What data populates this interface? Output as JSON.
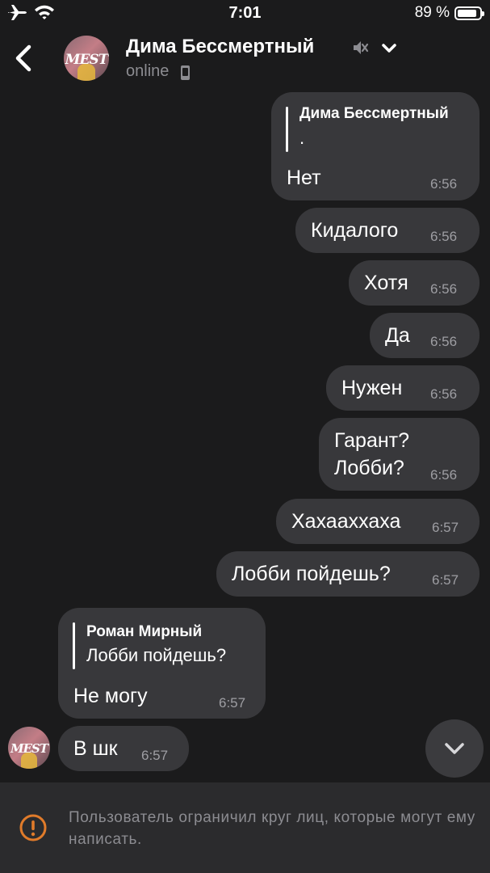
{
  "status_bar": {
    "time": "7:01",
    "battery_percent": "89 %",
    "battery_level": 0.89,
    "airplane_icon": "airplane-icon",
    "wifi_icon": "wifi-icon"
  },
  "header": {
    "back_icon": "chevron-left-icon",
    "avatar_text": "MEST",
    "contact_name": "Дима Бессмертный",
    "muted_icon": "speaker-muted-icon",
    "expand_icon": "chevron-down-icon",
    "status": "online"
  },
  "messages": [
    {
      "direction": "outgoing",
      "reply_author": "Дима Бессмертный",
      "reply_text": ".",
      "text": "Нет",
      "time": "6:56"
    },
    {
      "direction": "outgoing",
      "text": "Кидалого",
      "time": "6:56"
    },
    {
      "direction": "outgoing",
      "text": "Хотя",
      "time": "6:56"
    },
    {
      "direction": "outgoing",
      "text": "Да",
      "time": "6:56"
    },
    {
      "direction": "outgoing",
      "text": "Нужен",
      "time": "6:56"
    },
    {
      "direction": "outgoing",
      "text_line1": "Гарант?",
      "text_line2": "Лобби?",
      "time": "6:56"
    },
    {
      "direction": "outgoing",
      "text": "Хахааххаха",
      "time": "6:57"
    },
    {
      "direction": "outgoing",
      "text": "Лобби пойдешь?",
      "time": "6:57"
    },
    {
      "direction": "incoming",
      "reply_author": "Роман Мирный",
      "reply_text": "Лобби пойдешь?",
      "text": "Не могу",
      "time": "6:57"
    },
    {
      "direction": "incoming",
      "text": "В шк",
      "time": "6:57"
    }
  ],
  "scroll_down_icon": "chevron-down-icon",
  "restriction": {
    "icon": "warning-icon",
    "accent_color": "#e07b2a",
    "text": "Пользователь ограничил круг лиц, которые могут ему написать."
  }
}
